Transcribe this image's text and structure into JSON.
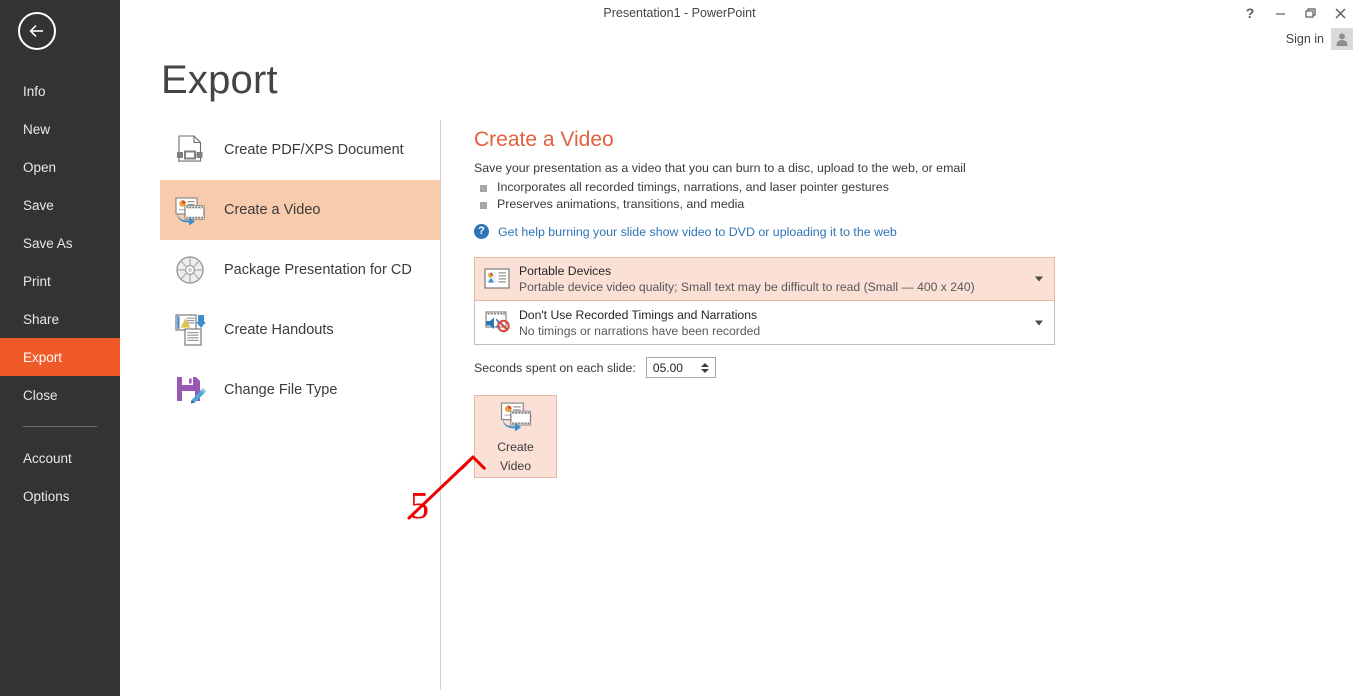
{
  "window": {
    "title": "Presentation1 - PowerPoint",
    "help_icon": "question-mark-icon",
    "minimize_icon": "minimize-icon",
    "restore_icon": "restore-icon",
    "close_icon": "close-icon",
    "sign_in_label": "Sign in",
    "avatar_icon": "account-avatar-icon"
  },
  "sidebar": {
    "back_icon": "back-arrow-icon",
    "items": [
      {
        "label": "Info",
        "active": false
      },
      {
        "label": "New",
        "active": false
      },
      {
        "label": "Open",
        "active": false
      },
      {
        "label": "Save",
        "active": false
      },
      {
        "label": "Save As",
        "active": false
      },
      {
        "label": "Print",
        "active": false
      },
      {
        "label": "Share",
        "active": false
      },
      {
        "label": "Export",
        "active": true
      },
      {
        "label": "Close",
        "active": false
      }
    ],
    "items_bottom": [
      {
        "label": "Account"
      },
      {
        "label": "Options"
      }
    ],
    "active_bg": "#f05a28",
    "bg": "#333333"
  },
  "page": {
    "title": "Export"
  },
  "export_options": [
    {
      "label": "Create PDF/XPS Document",
      "icon": "pdf-document-icon",
      "selected": false
    },
    {
      "label": "Create a Video",
      "icon": "create-video-icon",
      "selected": true
    },
    {
      "label": "Package Presentation for CD",
      "icon": "cd-disc-icon",
      "selected": false
    },
    {
      "label": "Create Handouts",
      "icon": "create-handouts-icon",
      "selected": false
    },
    {
      "label": "Change File Type",
      "icon": "change-file-type-icon",
      "selected": false
    }
  ],
  "detail": {
    "title": "Create a Video",
    "title_color": "#e2613e",
    "description": "Save your presentation as a video that you can burn to a disc, upload to the web, or email",
    "bullets": [
      "Incorporates all recorded timings, narrations, and laser pointer gestures",
      "Preserves animations, transitions, and media"
    ],
    "help_link": "Get help burning your slide show video to DVD or uploading it to the web",
    "help_link_color": "#2e75b6",
    "quality_dropdown": {
      "icon": "video-quality-icon",
      "primary": "Portable Devices",
      "secondary": "Portable device video quality; Small text may be difficult to read  (Small — 400 x 240)",
      "highlighted": true,
      "chevron_icon": "chevron-down-icon"
    },
    "timings_dropdown": {
      "icon": "no-narration-icon",
      "primary": "Don't Use Recorded Timings and Narrations",
      "secondary": "No timings or narrations have been recorded",
      "highlighted": false,
      "chevron_icon": "chevron-down-icon"
    },
    "seconds": {
      "label": "Seconds spent on each slide:",
      "value": "05.00",
      "up_icon": "spinner-up-icon",
      "down_icon": "spinner-down-icon"
    },
    "create_video_button": {
      "icon": "create-video-icon",
      "line1": "Create",
      "line2": "Video",
      "bg": "#fbe0d5"
    }
  },
  "annotation": {
    "number": "5",
    "color": "#ee0000",
    "arrow_icon": "annotation-arrow-icon"
  }
}
